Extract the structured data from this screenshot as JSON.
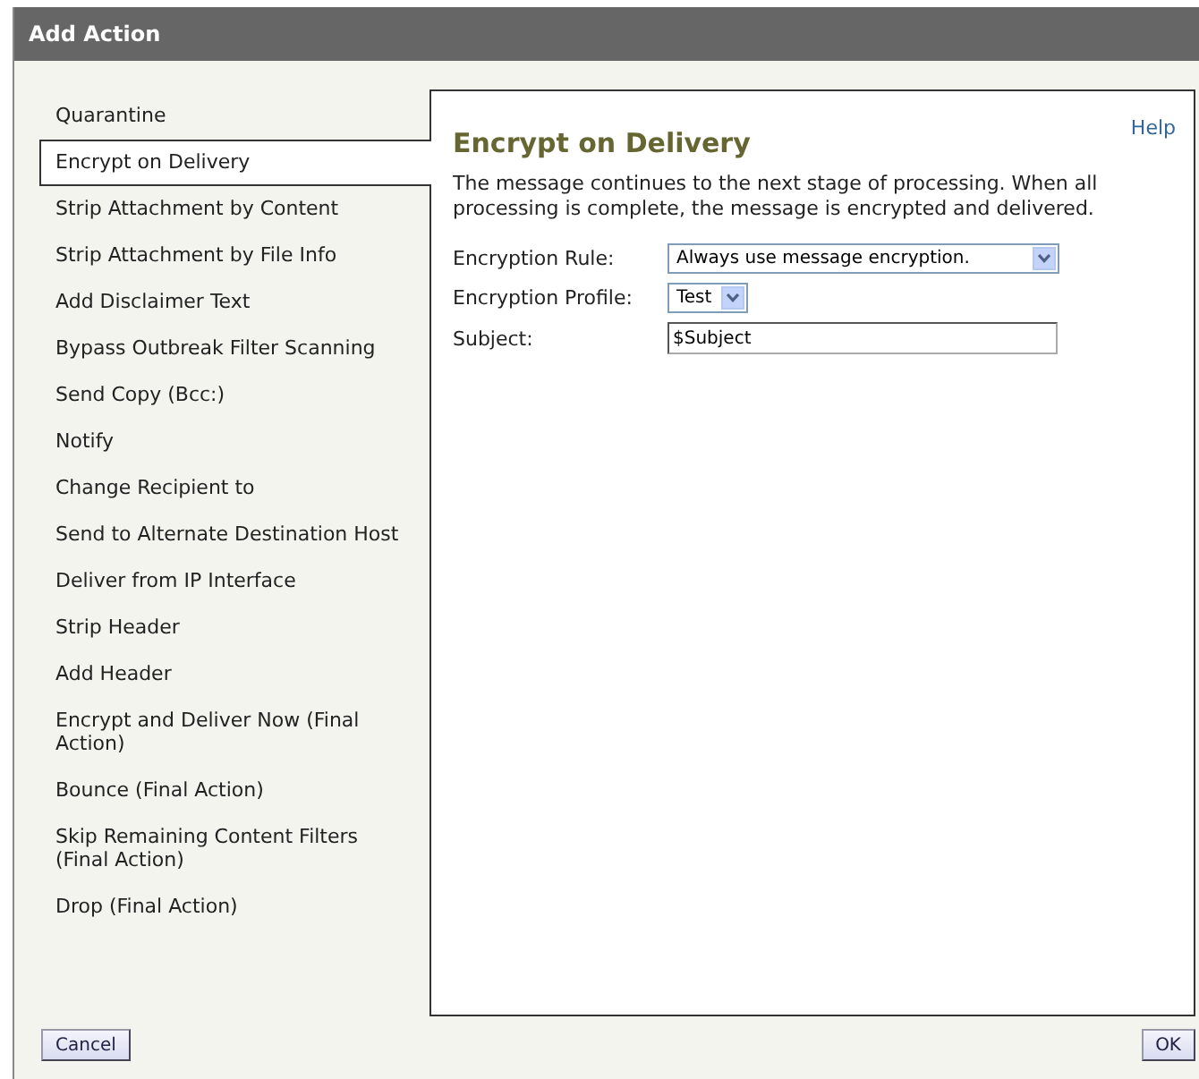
{
  "window": {
    "title": "Add Action"
  },
  "actions": [
    {
      "label": "Quarantine",
      "selected": false
    },
    {
      "label": "Encrypt on Delivery",
      "selected": true
    },
    {
      "label": "Strip Attachment by Content",
      "selected": false
    },
    {
      "label": "Strip Attachment by File Info",
      "selected": false
    },
    {
      "label": "Add Disclaimer Text",
      "selected": false
    },
    {
      "label": "Bypass Outbreak Filter Scanning",
      "selected": false
    },
    {
      "label": "Send Copy (Bcc:)",
      "selected": false
    },
    {
      "label": "Notify",
      "selected": false
    },
    {
      "label": "Change Recipient to",
      "selected": false
    },
    {
      "label": "Send to Alternate Destination Host",
      "selected": false
    },
    {
      "label": "Deliver from IP Interface",
      "selected": false
    },
    {
      "label": "Strip Header",
      "selected": false
    },
    {
      "label": "Add Header",
      "selected": false
    },
    {
      "label": "Encrypt and Deliver Now (Final Action)",
      "selected": false
    },
    {
      "label": "Bounce (Final Action)",
      "selected": false
    },
    {
      "label": "Skip Remaining Content Filters (Final Action)",
      "selected": false
    },
    {
      "label": "Drop (Final Action)",
      "selected": false
    }
  ],
  "panel": {
    "heading": "Encrypt on Delivery",
    "help_link": "Help",
    "description": "The message continues to the next stage of processing. When all processing is complete, the message is encrypted and delivered.",
    "fields": [
      {
        "kind": "wide-select",
        "label": "Encryption Rule:",
        "value": "Always use message encryption."
      },
      {
        "kind": "select",
        "label": "Encryption Profile:",
        "value": "Test"
      },
      {
        "kind": "text",
        "label": "Subject:",
        "value": "$Subject"
      }
    ]
  },
  "buttons": {
    "cancel": "Cancel",
    "ok": "OK"
  }
}
